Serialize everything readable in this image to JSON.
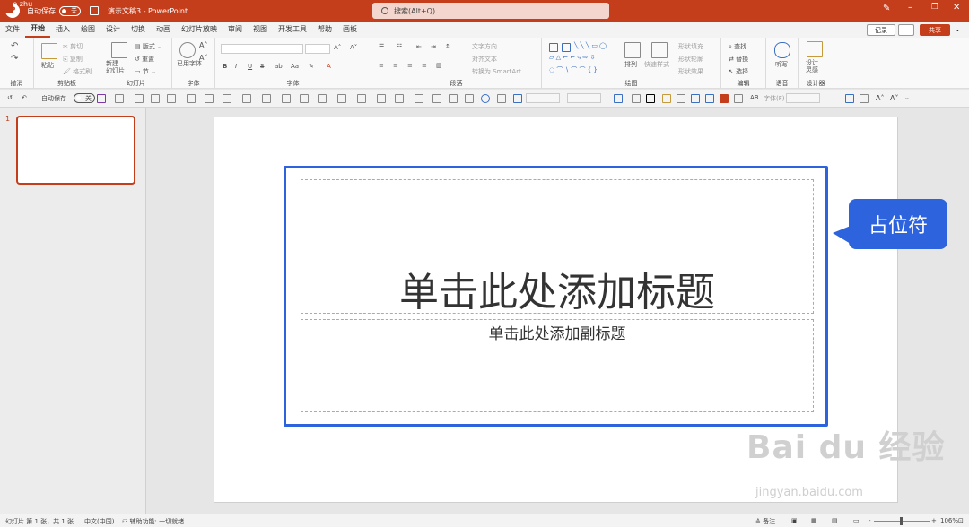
{
  "titlebar": {
    "autosave_label": "自动保存",
    "autosave_state": "关",
    "doc_title": "演示文稿3  -  PowerPoint",
    "search_placeholder": "搜索(Alt+Q)",
    "user_name": "chao zhu"
  },
  "menu": {
    "tabs": [
      "文件",
      "开始",
      "插入",
      "绘图",
      "设计",
      "切换",
      "动画",
      "幻灯片放映",
      "审阅",
      "视图",
      "开发工具",
      "帮助",
      "画板"
    ],
    "active_tab": "开始",
    "record_label": "记录",
    "share_label": "共享"
  },
  "ribbon": {
    "undo_group": "撤消",
    "clipboard": {
      "paste": "粘贴",
      "cut": "剪切",
      "copy": "复制",
      "format_painter": "格式刷",
      "label": "剪贴板"
    },
    "slides": {
      "new_slide": "新建\n幻灯片",
      "layout": "版式",
      "reset": "重置",
      "section": "节",
      "label": "幻灯片"
    },
    "font_group": {
      "common_font": "已用字体",
      "label": "字体"
    },
    "font_controls": {
      "label": "字体",
      "bold": "B",
      "italic": "I",
      "underline": "U",
      "strike": "S"
    },
    "paragraph": {
      "text_direction": "文字方向",
      "align_text": "对齐文本",
      "smartart": "转换为 SmartArt",
      "label": "段落"
    },
    "drawing": {
      "arrange": "排列",
      "quick_styles": "快速样式",
      "fill": "形状填充",
      "outline": "形状轮廓",
      "effects": "形状效果",
      "label": "绘图"
    },
    "editing": {
      "find": "查找",
      "replace": "替换",
      "select": "选择",
      "label": "编辑"
    },
    "voice": {
      "dictate": "听写",
      "label": "语音"
    },
    "designer": {
      "design_ideas": "设计\n灵感",
      "label": "设计器"
    }
  },
  "qat": {
    "autosave_label": "自动保存",
    "autosave_state": "关",
    "font_placeholder": "字体(F)"
  },
  "thumbnails": [
    {
      "number": "1"
    }
  ],
  "slide": {
    "title_placeholder": "单击此处添加标题",
    "subtitle_placeholder": "单击此处添加副标题"
  },
  "callout": {
    "text": "占位符"
  },
  "watermark": {
    "brand": "Bai du 经验",
    "url": "jingyan.baidu.com"
  },
  "statusbar": {
    "slide_info": "幻灯片 第 1 张，共 1 张",
    "language": "中文(中国)",
    "accessibility": "辅助功能: 一切就绪",
    "notes": "备注",
    "zoom": "106%",
    "zoom_minus": "-",
    "zoom_plus": "+"
  },
  "colors": {
    "accent": "#c43e1c",
    "highlight": "#2d63dd"
  }
}
